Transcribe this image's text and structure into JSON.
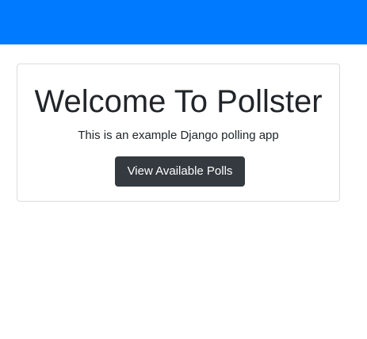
{
  "navbar": {
    "color": "#007bff"
  },
  "jumbotron": {
    "title": "Welcome To Pollster",
    "subtitle": "This is an example Django polling app",
    "button_label": "View Available Polls"
  },
  "colors": {
    "primary": "#007bff",
    "button_dark": "#343a40",
    "text": "#212529"
  }
}
